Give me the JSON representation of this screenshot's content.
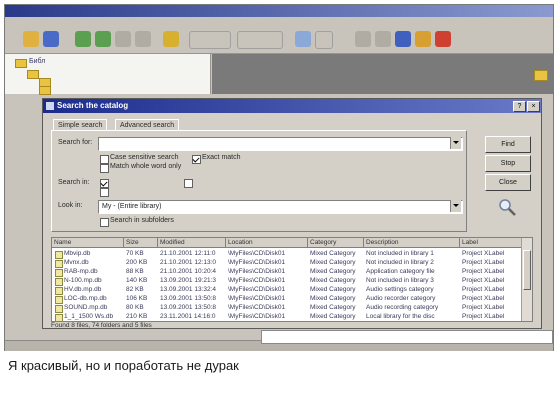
{
  "caption": "Я красивый, но и поработать не дурак",
  "colors": {
    "title_bar": "#1c2c8c",
    "window_bg": "#d4d0c8",
    "folder": "#e8c440",
    "info_panel": "#7a7a7a"
  },
  "main": {
    "tree": {
      "root_label": "Библ"
    }
  },
  "dialog": {
    "title": "Search the catalog",
    "tabs": [
      "Simple search",
      "Advanced search"
    ],
    "fields": {
      "search_for": {
        "label": "Search for:",
        "value": ""
      },
      "search_in": {
        "label": "Search in:"
      },
      "look_in": {
        "label": "Look in:",
        "value": "My - (Entire library)"
      }
    },
    "checkboxes": [
      {
        "label": "Case sensitive search",
        "checked": false
      },
      {
        "label": "Match whole word only",
        "checked": false
      },
      {
        "label": "Exact match",
        "checked": true
      },
      {
        "label": "Search in subfolders",
        "checked": false
      }
    ],
    "buttons": [
      "Find",
      "Stop",
      "Close"
    ],
    "results": {
      "columns": [
        "Name",
        "Size",
        "Modified",
        "Location",
        "Category",
        "Description",
        "Label"
      ],
      "rows": [
        [
          "Mbvip.db",
          "70 KB",
          "21.10.2001 12:11:0",
          "\\MyFiles\\CD\\Disk01",
          "Mixed Category",
          "Not included in library 1",
          "Project XLabel"
        ],
        [
          "Mvnx.db",
          "200 KB",
          "21.10.2001 12:13:0",
          "\\MyFiles\\CD\\Disk01",
          "Mixed Category",
          "Not included in library 2",
          "Project XLabel"
        ],
        [
          "RAB-mp.db",
          "88 KB",
          "21.10.2001 10:20:4",
          "\\MyFiles\\CD\\Disk01",
          "Mixed Category",
          "Application category file",
          "Project XLabel"
        ],
        [
          "N-100.mp.db",
          "140 KB",
          "13.09.2001 19:21:3",
          "\\MyFiles\\CD\\Disk01",
          "Mixed Category",
          "Not included in library 3",
          "Project XLabel"
        ],
        [
          "HV.db.mp.db",
          "82 KB",
          "13.09.2001 13:32:4",
          "\\MyFiles\\CD\\Disk01",
          "Mixed Category",
          "Audio settings category",
          "Project XLabel"
        ],
        [
          "LOC-db.mp.db",
          "106 KB",
          "13.09.2001 13:50:8",
          "\\MyFiles\\CD\\Disk01",
          "Mixed Category",
          "Audio recorder category",
          "Project XLabel"
        ],
        [
          "SOUND.mp.db",
          "80 KB",
          "13.09.2001 13:50:8",
          "\\MyFiles\\CD\\Disk01",
          "Mixed Category",
          "Audio recording category",
          "Project XLabel"
        ],
        [
          "1_1_1500 Ws.db",
          "210 KB",
          "23.11.2001 14:16:0",
          "\\MyFiles\\CD\\Disk01",
          "Mixed Category",
          "Local library for the disc",
          "Project XLabel"
        ]
      ]
    },
    "status": "Found 8 files, 74 folders and 5 files"
  }
}
